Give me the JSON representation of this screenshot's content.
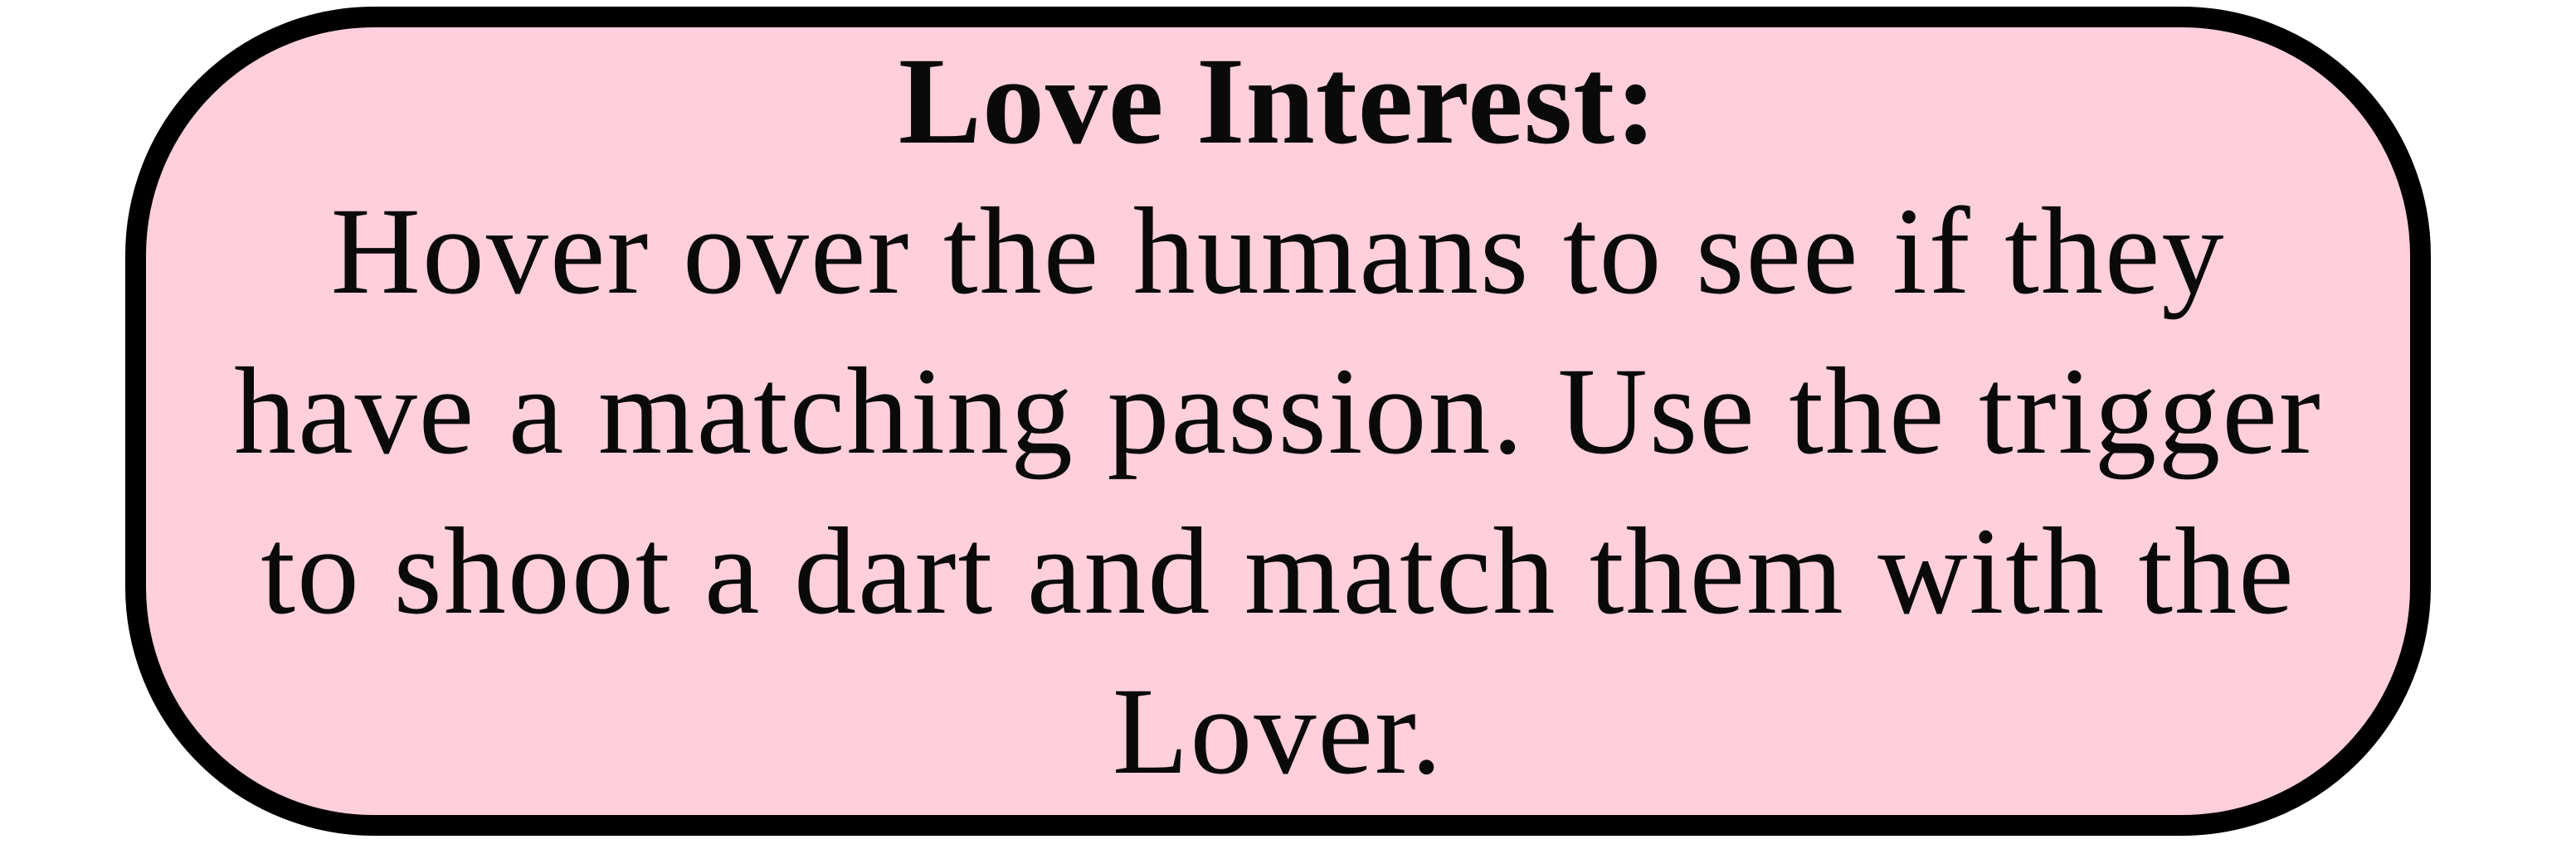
{
  "tooltip": {
    "title": "Love Interest:",
    "body_lines": [
      "Hover over the humans to see if they",
      "have a matching passion. Use the trigger",
      "to shoot a dart and match them with the",
      "Lover."
    ],
    "background_color": "#ffcfdc",
    "border_color": "#000000",
    "text_color": "#0a0a0a"
  }
}
